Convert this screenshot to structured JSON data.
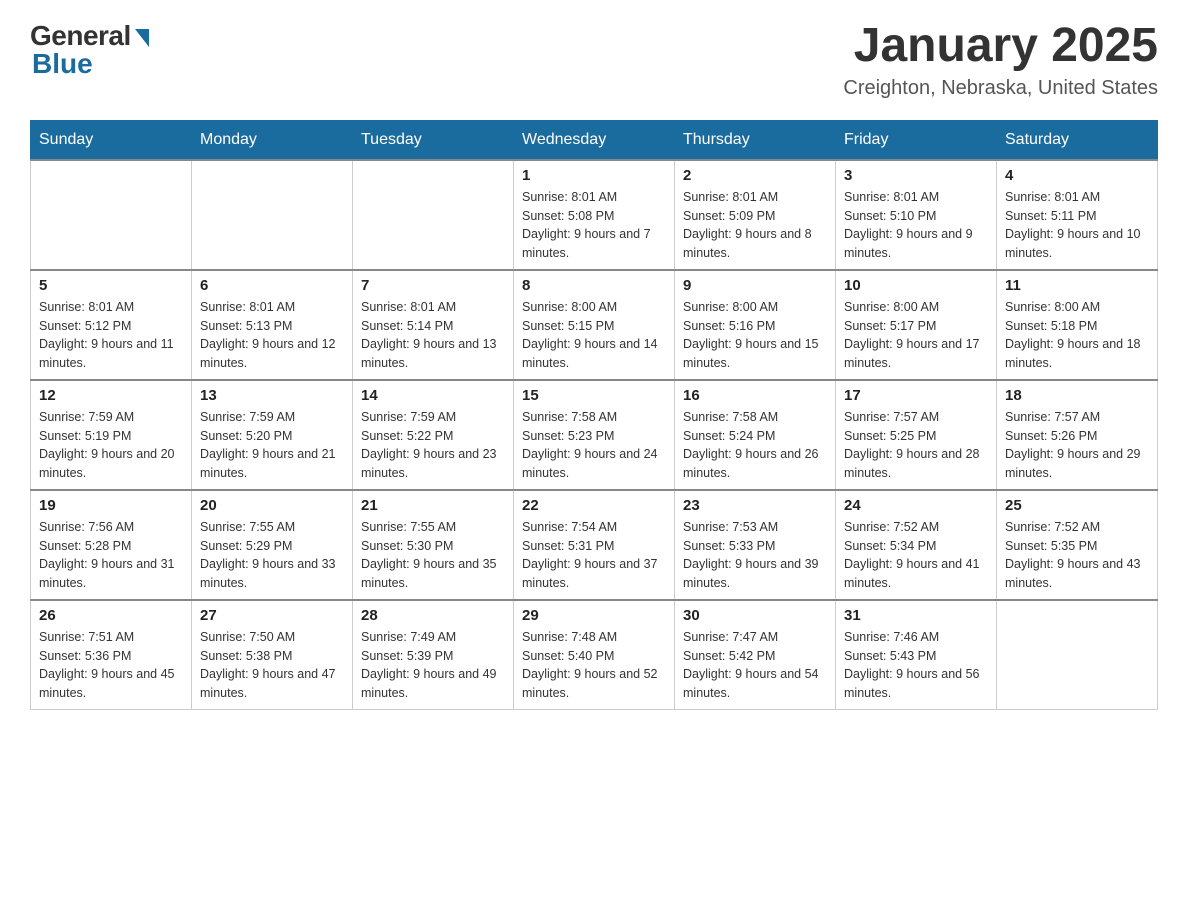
{
  "header": {
    "logo_general": "General",
    "logo_blue": "Blue",
    "month_title": "January 2025",
    "location": "Creighton, Nebraska, United States"
  },
  "days_of_week": [
    "Sunday",
    "Monday",
    "Tuesday",
    "Wednesday",
    "Thursday",
    "Friday",
    "Saturday"
  ],
  "weeks": [
    [
      {
        "day": "",
        "info": ""
      },
      {
        "day": "",
        "info": ""
      },
      {
        "day": "",
        "info": ""
      },
      {
        "day": "1",
        "info": "Sunrise: 8:01 AM\nSunset: 5:08 PM\nDaylight: 9 hours and 7 minutes."
      },
      {
        "day": "2",
        "info": "Sunrise: 8:01 AM\nSunset: 5:09 PM\nDaylight: 9 hours and 8 minutes."
      },
      {
        "day": "3",
        "info": "Sunrise: 8:01 AM\nSunset: 5:10 PM\nDaylight: 9 hours and 9 minutes."
      },
      {
        "day": "4",
        "info": "Sunrise: 8:01 AM\nSunset: 5:11 PM\nDaylight: 9 hours and 10 minutes."
      }
    ],
    [
      {
        "day": "5",
        "info": "Sunrise: 8:01 AM\nSunset: 5:12 PM\nDaylight: 9 hours and 11 minutes."
      },
      {
        "day": "6",
        "info": "Sunrise: 8:01 AM\nSunset: 5:13 PM\nDaylight: 9 hours and 12 minutes."
      },
      {
        "day": "7",
        "info": "Sunrise: 8:01 AM\nSunset: 5:14 PM\nDaylight: 9 hours and 13 minutes."
      },
      {
        "day": "8",
        "info": "Sunrise: 8:00 AM\nSunset: 5:15 PM\nDaylight: 9 hours and 14 minutes."
      },
      {
        "day": "9",
        "info": "Sunrise: 8:00 AM\nSunset: 5:16 PM\nDaylight: 9 hours and 15 minutes."
      },
      {
        "day": "10",
        "info": "Sunrise: 8:00 AM\nSunset: 5:17 PM\nDaylight: 9 hours and 17 minutes."
      },
      {
        "day": "11",
        "info": "Sunrise: 8:00 AM\nSunset: 5:18 PM\nDaylight: 9 hours and 18 minutes."
      }
    ],
    [
      {
        "day": "12",
        "info": "Sunrise: 7:59 AM\nSunset: 5:19 PM\nDaylight: 9 hours and 20 minutes."
      },
      {
        "day": "13",
        "info": "Sunrise: 7:59 AM\nSunset: 5:20 PM\nDaylight: 9 hours and 21 minutes."
      },
      {
        "day": "14",
        "info": "Sunrise: 7:59 AM\nSunset: 5:22 PM\nDaylight: 9 hours and 23 minutes."
      },
      {
        "day": "15",
        "info": "Sunrise: 7:58 AM\nSunset: 5:23 PM\nDaylight: 9 hours and 24 minutes."
      },
      {
        "day": "16",
        "info": "Sunrise: 7:58 AM\nSunset: 5:24 PM\nDaylight: 9 hours and 26 minutes."
      },
      {
        "day": "17",
        "info": "Sunrise: 7:57 AM\nSunset: 5:25 PM\nDaylight: 9 hours and 28 minutes."
      },
      {
        "day": "18",
        "info": "Sunrise: 7:57 AM\nSunset: 5:26 PM\nDaylight: 9 hours and 29 minutes."
      }
    ],
    [
      {
        "day": "19",
        "info": "Sunrise: 7:56 AM\nSunset: 5:28 PM\nDaylight: 9 hours and 31 minutes."
      },
      {
        "day": "20",
        "info": "Sunrise: 7:55 AM\nSunset: 5:29 PM\nDaylight: 9 hours and 33 minutes."
      },
      {
        "day": "21",
        "info": "Sunrise: 7:55 AM\nSunset: 5:30 PM\nDaylight: 9 hours and 35 minutes."
      },
      {
        "day": "22",
        "info": "Sunrise: 7:54 AM\nSunset: 5:31 PM\nDaylight: 9 hours and 37 minutes."
      },
      {
        "day": "23",
        "info": "Sunrise: 7:53 AM\nSunset: 5:33 PM\nDaylight: 9 hours and 39 minutes."
      },
      {
        "day": "24",
        "info": "Sunrise: 7:52 AM\nSunset: 5:34 PM\nDaylight: 9 hours and 41 minutes."
      },
      {
        "day": "25",
        "info": "Sunrise: 7:52 AM\nSunset: 5:35 PM\nDaylight: 9 hours and 43 minutes."
      }
    ],
    [
      {
        "day": "26",
        "info": "Sunrise: 7:51 AM\nSunset: 5:36 PM\nDaylight: 9 hours and 45 minutes."
      },
      {
        "day": "27",
        "info": "Sunrise: 7:50 AM\nSunset: 5:38 PM\nDaylight: 9 hours and 47 minutes."
      },
      {
        "day": "28",
        "info": "Sunrise: 7:49 AM\nSunset: 5:39 PM\nDaylight: 9 hours and 49 minutes."
      },
      {
        "day": "29",
        "info": "Sunrise: 7:48 AM\nSunset: 5:40 PM\nDaylight: 9 hours and 52 minutes."
      },
      {
        "day": "30",
        "info": "Sunrise: 7:47 AM\nSunset: 5:42 PM\nDaylight: 9 hours and 54 minutes."
      },
      {
        "day": "31",
        "info": "Sunrise: 7:46 AM\nSunset: 5:43 PM\nDaylight: 9 hours and 56 minutes."
      },
      {
        "day": "",
        "info": ""
      }
    ]
  ]
}
